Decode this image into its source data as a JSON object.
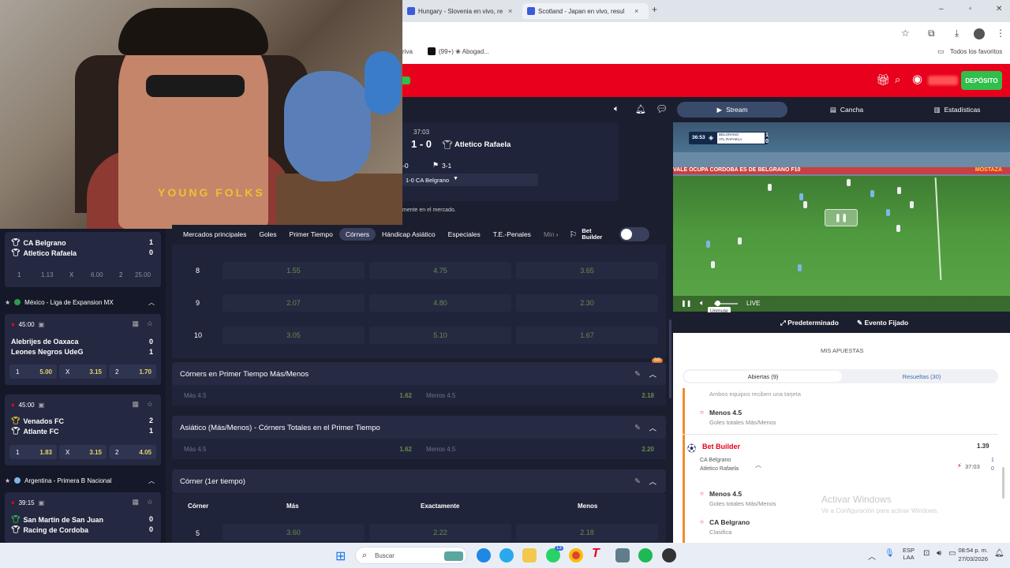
{
  "browser": {
    "tabs": [
      {
        "label": "Hungary - Slovenia en vivo, re",
        "close": "×"
      },
      {
        "label": "Scotland - Japan en vivo, resul",
        "close": "×"
      }
    ],
    "new_tab": "+",
    "bookmarks": [
      {
        "label": "riva"
      },
      {
        "label": "(99+) ❀ Abogad..."
      }
    ],
    "favorites_label": "Todos los favoritos"
  },
  "site_header": {
    "deposit_label": "DEPÓSITO"
  },
  "webcam": {
    "shirt_text": "YOUNG FOLKS"
  },
  "match_header": {
    "clock": "37:03",
    "score": "1 - 0",
    "away_team": "Atletico Rafaela",
    "stat_left": "-0",
    "stat_corners": "3-1",
    "scorer_line": "1-0 CA Belgrano",
    "market_note": "mente en el mercado."
  },
  "market_tabs": [
    "Mercados principales",
    "Goles",
    "Primer Tiempo",
    "Córners",
    "Hándicap Asiático",
    "Especiales",
    "T.E.-Penales",
    "Min"
  ],
  "bet_builder_label": "Bet\nBuilder",
  "corners_table": {
    "rows": [
      {
        "line": "8",
        "odds": [
          "1.55",
          "4.75",
          "3.65"
        ]
      },
      {
        "line": "9",
        "odds": [
          "2.07",
          "4.80",
          "2.30"
        ]
      },
      {
        "line": "10",
        "odds": [
          "3.05",
          "5.10",
          "1.67"
        ]
      }
    ]
  },
  "sections": [
    {
      "title": "Córners en Primer Tiempo Más/Menos",
      "badge": "BB",
      "over_label": "Más 4.5",
      "over_odd": "1.62",
      "under_label": "Menos 4.5",
      "under_odd": "2.18"
    },
    {
      "title": "Asiático (Más/Menos) - Córners Totales en el Primer Tiempo",
      "over_label": "Más 4.5",
      "over_odd": "1.62",
      "under_label": "Menos 4.5",
      "under_odd": "2.20"
    },
    {
      "title": "Córner (1er tiempo)",
      "columns": [
        "Córner",
        "Más",
        "Exactamente",
        "Menos"
      ],
      "rows": [
        {
          "line": "5",
          "odds": [
            "3.60",
            "2.22",
            "2.18"
          ]
        }
      ]
    }
  ],
  "left_panel": {
    "match1": {
      "home": "CA Belgrano",
      "home_score": "1",
      "away": "Atletico Rafaela",
      "away_score": "0",
      "odds": [
        {
          "k": "1",
          "v": "1.13"
        },
        {
          "k": "X",
          "v": "6.00"
        },
        {
          "k": "2",
          "v": "25.00"
        }
      ]
    },
    "league1": "México - Liga de Expansion MX",
    "match2": {
      "time": "45:00",
      "home": "Alebrijes de Oaxaca",
      "home_score": "0",
      "away": "Leones Negros UdeG",
      "away_score": "1",
      "odds": [
        {
          "k": "1",
          "v": "5.00"
        },
        {
          "k": "X",
          "v": "3.15"
        },
        {
          "k": "2",
          "v": "1.70"
        }
      ]
    },
    "match3": {
      "time": "45:00",
      "home": "Venados FC",
      "home_score": "2",
      "away": "Atlante FC",
      "away_score": "1",
      "odds": [
        {
          "k": "1",
          "v": "1.83"
        },
        {
          "k": "X",
          "v": "3.15"
        },
        {
          "k": "2",
          "v": "4.05"
        }
      ]
    },
    "league2": "Argentina - Primera B Nacional",
    "match4": {
      "time": "39:15",
      "home": "San Martin de San Juan",
      "home_score": "0",
      "away": "Racing de Cordoba",
      "away_score": "0"
    }
  },
  "right_panel": {
    "tabs": [
      "Stream",
      "Cancha",
      "Estadísticas"
    ],
    "video": {
      "clock": "36:53",
      "team1": "BELGRANO",
      "team2": "ATL RAFAELA",
      "s1": "1",
      "s2": "0",
      "banner": "VALE    OCUPA CORDOBA ES DE BELGRANO    F10",
      "sponsor": "MOSTAZA",
      "tooltip": "Unmute",
      "live": "LIVE"
    },
    "stream_options": [
      "Predeterminado",
      "Evento Fijado"
    ],
    "my_bets_title": "MIS APUESTAS",
    "bet_tabs": [
      "Abiertas (9)",
      "Resueltas (30)"
    ],
    "bets": {
      "prev_line": "Ambos equipos reciben una tarjeta",
      "sel1_title": "Menos 4.5",
      "sel1_sub": "Goles totales Más/Menos",
      "builder_title": "Bet Builder",
      "builder_odd": "1.39",
      "team_a": "CA Belgrano",
      "team_b": "Atletico Rafaela",
      "clock": "37:03",
      "score_a": "1",
      "score_b": "0",
      "sel2_title": "Menos 4.5",
      "sel2_sub": "Goles totales Más/Menos",
      "sel3_title": "CA Belgrano",
      "sel3_sub": "Clasifica"
    },
    "watermark_title": "Activar Windows",
    "watermark_sub": "Ve a Configuración para activar Windows."
  },
  "taskbar": {
    "search": "Buscar",
    "lang": "ESP\nLAA",
    "time": "08:54 p. m.",
    "date": "27/03/2026",
    "whatsapp_badge": "13"
  }
}
